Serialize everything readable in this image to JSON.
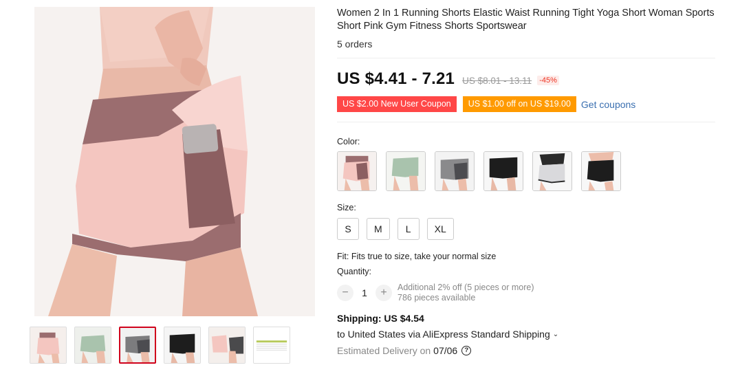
{
  "product": {
    "title": "Women 2 In 1 Running Shorts Elastic Waist Running Tight Yoga Short Woman Sports Short Pink Gym Fitness Shorts Sportswear",
    "orders": "5 orders"
  },
  "price": {
    "current": "US $4.41 - 7.21",
    "original": "US $8.01 - 13.11",
    "discount": "-45%"
  },
  "coupons": {
    "new_user": "US $2.00 New User Coupon",
    "store": "US $1.00 off on US $19.00",
    "get_label": "Get coupons"
  },
  "color": {
    "label": "Color:",
    "options": [
      "pink",
      "sage-green",
      "grey",
      "black",
      "white-grey",
      "black-white"
    ]
  },
  "size": {
    "label": "Size:",
    "options": [
      "S",
      "M",
      "L",
      "XL"
    ]
  },
  "fit": "Fit: Fits true to size, take your normal size",
  "quantity": {
    "label": "Quantity:",
    "minus": "−",
    "value": "1",
    "plus": "+",
    "note_line1": "Additional 2% off (5 pieces or more)",
    "note_line2": "786 pieces available"
  },
  "shipping": {
    "title": "Shipping: US $4.54",
    "destination": "to United States via AliExpress Standard Shipping",
    "chevron": "⌄",
    "delivery_label": "Estimated Delivery on",
    "delivery_date": "07/06",
    "help": "?"
  },
  "colors": {
    "price_text": "#111111",
    "coupon_red": "#ff4747",
    "coupon_orange": "#ff9a00",
    "link": "#3a6fb0",
    "active_thumb": "#d0021b"
  }
}
